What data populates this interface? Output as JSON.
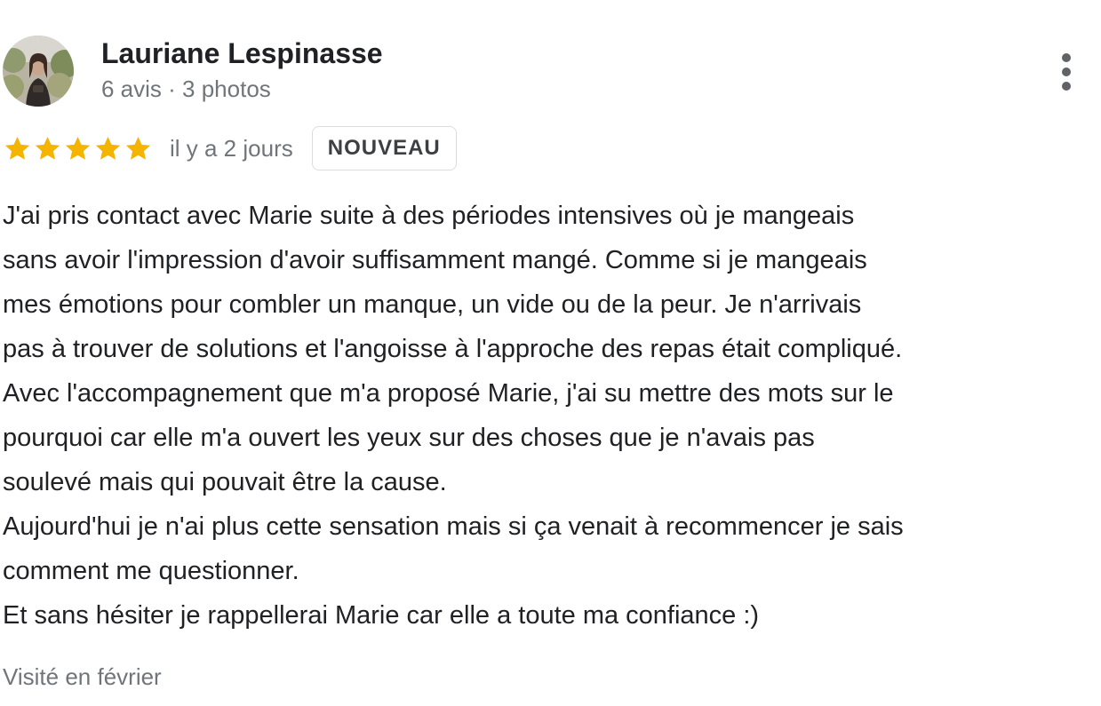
{
  "review": {
    "author": {
      "name": "Lauriane Lespinasse",
      "meta": "6 avis · 3 photos",
      "avatar_icon": "profile-photo"
    },
    "more_icon": "more-vertical-icon",
    "rating": {
      "stars": 5,
      "max_stars": 5,
      "star_color": "#f4b400",
      "time_ago": "il y a 2 jours",
      "badge": "NOUVEAU"
    },
    "text_lines": [
      "J'ai pris contact avec Marie suite à des périodes intensives où je mangeais",
      "sans avoir l'impression d'avoir suffisamment mangé. Comme si je mangeais",
      "mes émotions pour combler un manque, un vide ou de la peur. Je n'arrivais",
      "pas à trouver de solutions et l'angoisse à l'approche des repas était compliqué.",
      "Avec l'accompagnement que m'a proposé Marie, j'ai su mettre des mots sur le",
      "pourquoi car elle m'a ouvert les yeux sur des choses que je n'avais pas",
      "soulevé mais qui pouvait être la cause.",
      "Aujourd'hui je n'ai plus cette sensation mais si ça venait à recommencer je sais",
      "comment me questionner.",
      "Et sans hésiter je rappellerai Marie car elle a toute ma confiance :)"
    ],
    "visit": "Visité en février"
  },
  "colors": {
    "text_primary": "#202124",
    "text_secondary": "#70757a",
    "star": "#f4b400",
    "badge_border": "#dadce0"
  }
}
